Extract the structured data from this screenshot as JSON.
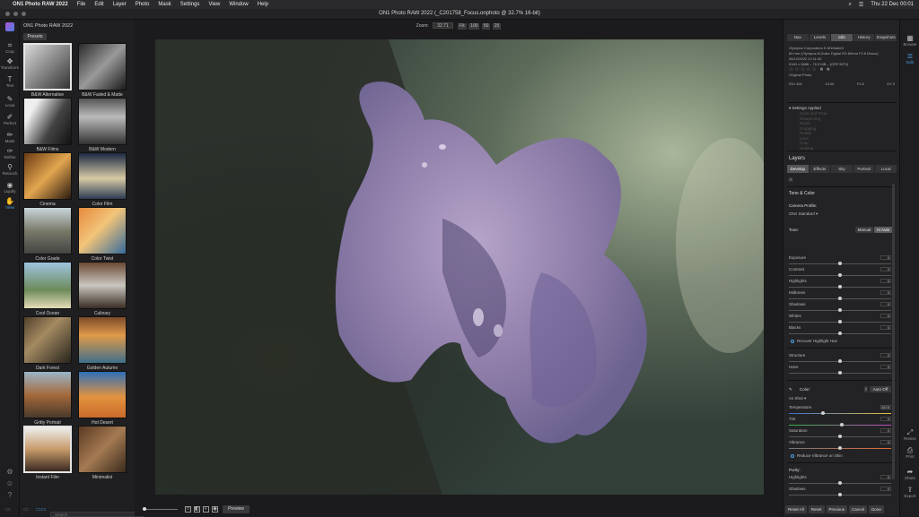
{
  "menubar": {
    "apple": "",
    "items": [
      "ON1 Photo RAW 2022",
      "File",
      "Edit",
      "Layer",
      "Photo",
      "Mask",
      "Settings",
      "View",
      "Window",
      "Help"
    ],
    "clock": "Thu 22 Dec  00:01"
  },
  "window": {
    "title": "ON1 Photo RAW 2022 (_C201758_Focus.onphoto @ 32.7% 16-bit)"
  },
  "left_tools": [
    {
      "label": "Crop",
      "icon": "crop-icon",
      "glyph": "⌗"
    },
    {
      "label": "Transform",
      "icon": "transform-icon",
      "glyph": "✥"
    },
    {
      "label": "Text",
      "icon": "text-icon",
      "glyph": "T"
    },
    {
      "label": "Local",
      "icon": "brush-icon",
      "glyph": "✎"
    },
    {
      "label": "Perfect",
      "icon": "perfect-brush-icon",
      "glyph": "✐"
    },
    {
      "label": "Mask",
      "icon": "mask-icon",
      "glyph": "✏"
    },
    {
      "label": "Refine",
      "icon": "refine-icon",
      "glyph": "✑"
    },
    {
      "label": "Retouch",
      "icon": "retouch-icon",
      "glyph": "⚲"
    },
    {
      "label": "Liquify",
      "icon": "liquify-icon",
      "glyph": "◉"
    },
    {
      "label": "View",
      "icon": "view-icon",
      "glyph": "✋"
    }
  ],
  "browser": {
    "title": "ON1 Photo RAW 2022",
    "presets_button": "Presets",
    "search_placeholder": "Search",
    "presets": [
      {
        "label": "B&W Alternative",
        "selected": true
      },
      {
        "label": "B&W Faded & Matte",
        "selected": false
      },
      {
        "label": "B&W Films",
        "selected": false
      },
      {
        "label": "B&W Modern",
        "selected": false
      },
      {
        "label": "Cinema",
        "selected": false
      },
      {
        "label": "Color Film",
        "selected": false
      },
      {
        "label": "Color Grade",
        "selected": false
      },
      {
        "label": "Color Twist",
        "selected": false
      },
      {
        "label": "Cool Ocean",
        "selected": false
      },
      {
        "label": "Culinary",
        "selected": false
      },
      {
        "label": "Dark Forest",
        "selected": false
      },
      {
        "label": "Golden Autumn",
        "selected": false
      },
      {
        "label": "Gritty Portrait",
        "selected": false
      },
      {
        "label": "Hot Desert",
        "selected": false
      },
      {
        "label": "Instant Film",
        "selected": true
      },
      {
        "label": "Minimalist",
        "selected": false
      }
    ]
  },
  "zoom": {
    "label": "Zoom:",
    "value": "32.71",
    "fit": "Fit",
    "presets": [
      "100",
      "50",
      "25"
    ]
  },
  "bottombar": {
    "preview": "Preview"
  },
  "right": {
    "tabs": [
      "Nav",
      "Levels",
      "Info",
      "History",
      "Snapshots"
    ],
    "active_tab": "Info",
    "info": {
      "camera": "Olympus Corporation E-M1MarkIII",
      "lens": "60 mm (Olympus M.Zuiko Digital ED 60mm F2.8 Macro)",
      "date": "06/12/2022 12:11:00",
      "dims": "5184 x 3888 – 76.9 MB – (ORF/NTD)",
      "original": "Original Photo",
      "iso": "ISO 400",
      "shutter": "1/100",
      "aperture": "F2.8",
      "exp": "EV 0"
    },
    "settings_applied": "Settings Applied",
    "settings_items": [
      "Color and Tone",
      "Sharpening",
      "Noise",
      "Cropping",
      "Rotate",
      "Lens",
      "Crop",
      "Healing"
    ],
    "layers_title": "Layers",
    "layer_tabs": [
      "Develop",
      "Effects",
      "Sky",
      "Portrait",
      "Local"
    ],
    "active_layer_tab": "Develop",
    "tone_color": "Tone & Color",
    "camera_profile_label": "Camera Profile:",
    "camera_profile_value": "ON1 Standard",
    "tone_label": "Tone:",
    "tone_modes": [
      "Manual",
      "AI Auto"
    ],
    "adjustments": [
      {
        "name": "Exposure",
        "value": "0",
        "pos": 0.5
      },
      {
        "name": "Contrast",
        "value": "0",
        "pos": 0.5
      },
      {
        "name": "Highlights",
        "value": "0",
        "pos": 0.5
      },
      {
        "name": "Midtones",
        "value": "0",
        "pos": 0.5
      },
      {
        "name": "Shadows",
        "value": "0",
        "pos": 0.5
      },
      {
        "name": "Whites",
        "value": "0",
        "pos": 0.5
      },
      {
        "name": "Blacks",
        "value": "0",
        "pos": 0.5
      }
    ],
    "recover_highlight": "Recover Highlight Hue",
    "structure": [
      {
        "name": "Structure",
        "value": "0",
        "pos": 0.5
      },
      {
        "name": "Haze",
        "value": "0",
        "pos": 0.5
      }
    ],
    "color_label": "Color:",
    "auto_off": "Auto Off",
    "as_shot": "As Shot",
    "color_adj": [
      {
        "name": "Temperature",
        "value": "3878",
        "pos": 0.33
      },
      {
        "name": "Tint",
        "value": "0",
        "pos": 0.52
      },
      {
        "name": "Saturation",
        "value": "0",
        "pos": 0.5
      },
      {
        "name": "Vibrance",
        "value": "0",
        "pos": 0.5
      }
    ],
    "reduce_vibrance": "Reduce Vibrance on Skin",
    "purity_label": "Purity:",
    "purity_adj": [
      {
        "name": "Highlights",
        "value": "0",
        "pos": 0.5
      },
      {
        "name": "Shadows",
        "value": "0",
        "pos": 0.5
      }
    ],
    "bottom_buttons": [
      "Reset All",
      "Reset",
      "Previous",
      "Cancel",
      "Done"
    ]
  },
  "right_tools": [
    {
      "label": "Browse",
      "icon": "browse-icon",
      "glyph": "▦"
    },
    {
      "label": "Edit",
      "icon": "edit-icon",
      "glyph": "≣"
    },
    {
      "label": "Resize",
      "icon": "resize-icon",
      "glyph": "⤢"
    },
    {
      "label": "Print",
      "icon": "print-icon",
      "glyph": "⎙"
    },
    {
      "label": "Share",
      "icon": "share-icon",
      "glyph": "➦"
    },
    {
      "label": "Export",
      "icon": "export-icon",
      "glyph": "⇪"
    }
  ]
}
